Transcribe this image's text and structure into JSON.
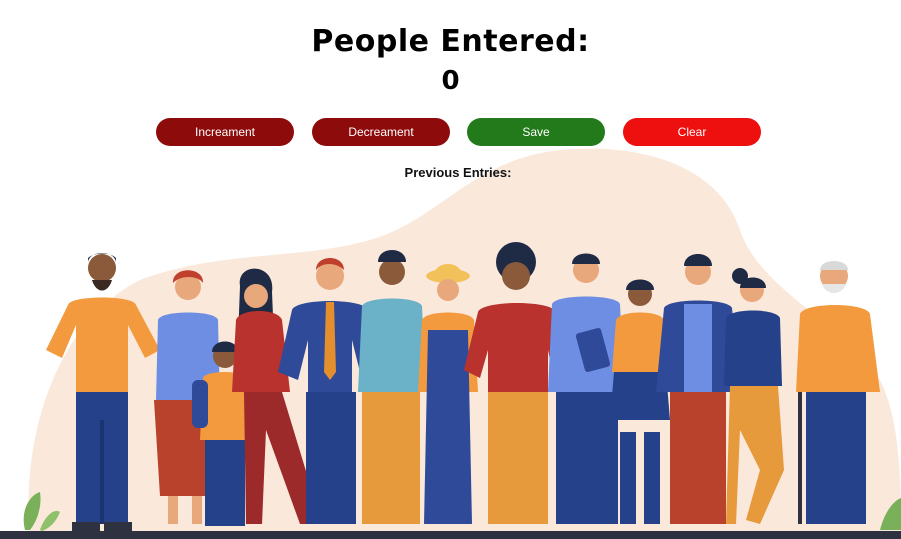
{
  "header": {
    "title": "People Entered:",
    "count": "0"
  },
  "buttons": {
    "increment_label": "Increament",
    "decrement_label": "Decreament",
    "save_label": "Save",
    "clear_label": "Clear"
  },
  "entries": {
    "label": "Previous Entries:"
  },
  "colors": {
    "increment": "#8e0b0b",
    "decrement": "#8e0b0b",
    "save": "#237a1a",
    "clear": "#ee0f0f",
    "blob": "#fae8da"
  },
  "illustration": {
    "icon": "crowd-of-people-illustration"
  }
}
